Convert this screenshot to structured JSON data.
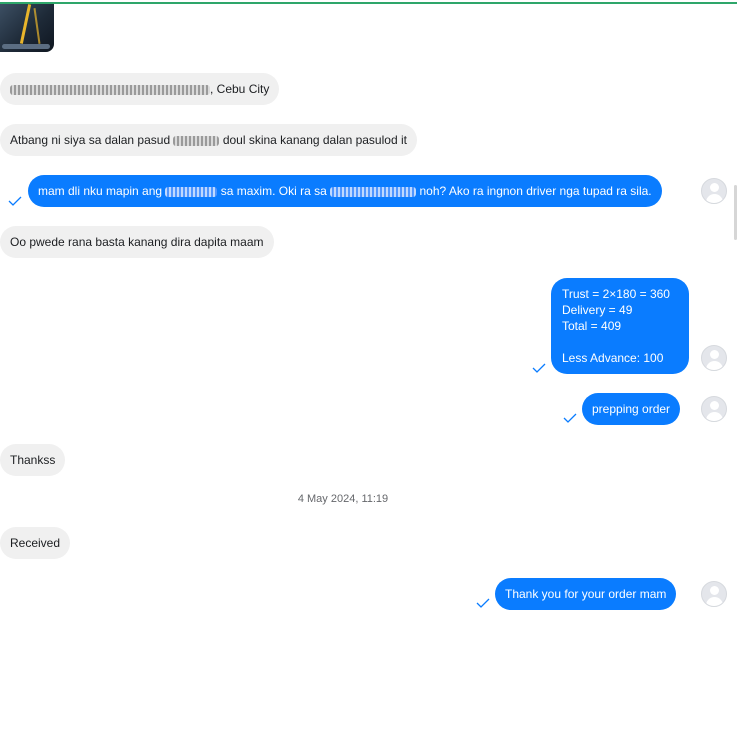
{
  "messages": {
    "location_suffix": ", Cebu City",
    "directions_prefix": "Atbang ni siya sa dalan pasud",
    "directions_suffix": "doul skina kanang dalan pasulod it",
    "reply_part1": "mam dli nku mapin ang",
    "reply_part2": "sa maxim. Oki ra sa",
    "reply_part3": "noh? Ako ra ingnon driver nga tupad ra sila.",
    "customer_ok": "Oo pwede rana basta kanang dira dapita maam",
    "order_summary": "Trust = 2×180 = 360\nDelivery = 49\nTotal = 409\n\nLess Advance: 100",
    "prepping": "prepping order",
    "thanks": "Thankss",
    "date_separator": "4 May 2024, 11:19",
    "received": "Received",
    "thank_you": "Thank you for your order mam"
  },
  "colors": {
    "outgoing_bubble": "#0a7cff",
    "incoming_bubble": "#f0f0f0",
    "top_border": "#2ea66a"
  },
  "icons": {
    "delivered": "check-icon",
    "avatar": "user-avatar-icon"
  }
}
